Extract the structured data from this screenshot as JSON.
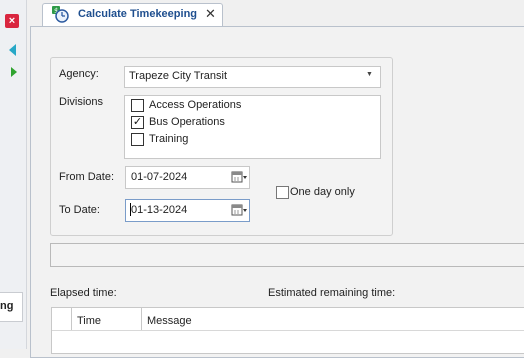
{
  "window": {
    "tab_title": "Calculate Timekeeping",
    "close_glyph": "✕",
    "left_tab_label": "ng"
  },
  "form": {
    "agency_label": "Agency:",
    "agency_value": "Trapeze City Transit",
    "divisions_label": "Divisions",
    "divisions": [
      {
        "label": "Access Operations",
        "checked": false
      },
      {
        "label": "Bus Operations",
        "checked": true
      },
      {
        "label": "Training",
        "checked": false
      }
    ],
    "from_date_label": "From Date:",
    "from_date_value": "01-07-2024",
    "to_date_label": "To Date:",
    "to_date_value": "01-13-2024",
    "one_day_only_label": "One day only",
    "one_day_only_checked": false
  },
  "status": {
    "elapsed_label": "Elapsed time:",
    "remaining_label": "Estimated remaining time:"
  },
  "grid": {
    "columns": [
      "Time",
      "Message"
    ]
  },
  "icons": {
    "close_document": "close-x-icon",
    "nav_left": "arrow-left-icon",
    "nav_right": "arrow-right-icon",
    "tab": "calculator-clock-icon",
    "calendar": "calendar-icon"
  },
  "colors": {
    "accent": "#1f4f8f",
    "close_red": "#d9263f",
    "nav_teal": "#27a8c7",
    "nav_green": "#2fa32f"
  }
}
